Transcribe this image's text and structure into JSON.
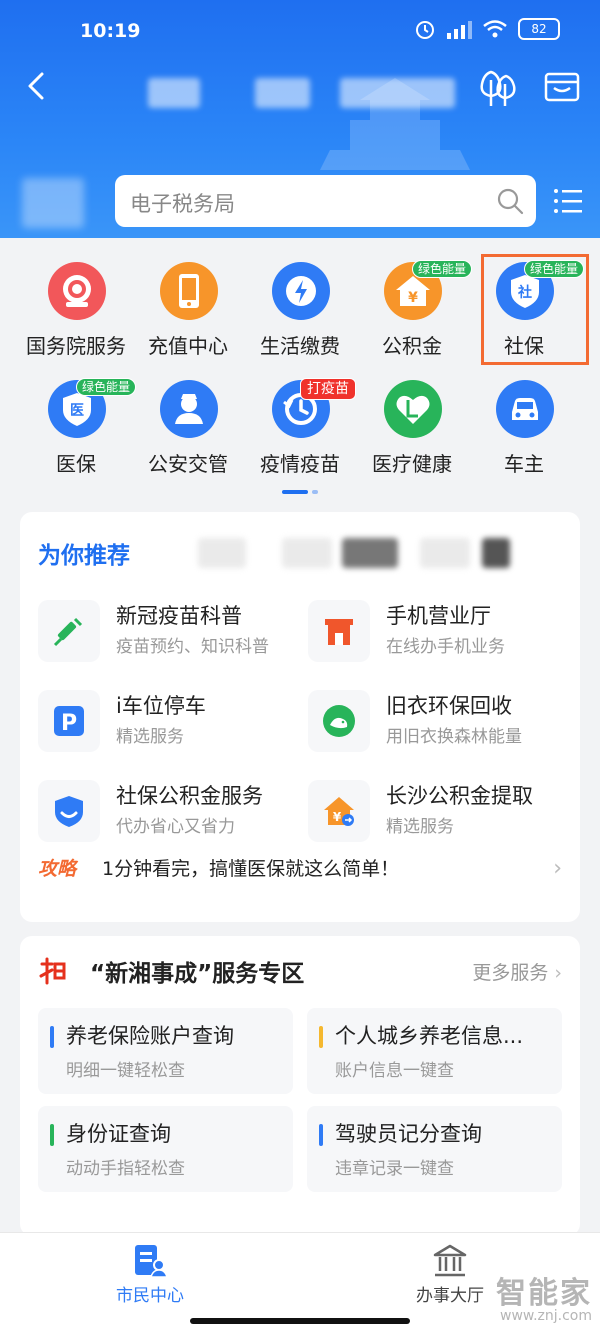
{
  "status_bar": {
    "time": "10:19",
    "battery": "82"
  },
  "header": {
    "search_placeholder": "电子税务局",
    "colors": {
      "primary": "#1f6ff0"
    }
  },
  "grid": {
    "items": [
      {
        "label": "国务院服务",
        "icon": "seal-icon"
      },
      {
        "label": "充值中心",
        "icon": "phone-icon"
      },
      {
        "label": "生活缴费",
        "icon": "lightning-icon"
      },
      {
        "label": "公积金",
        "icon": "house-yuan-icon",
        "badge": "绿色能量"
      },
      {
        "label": "社保",
        "icon": "shield-social-icon",
        "badge": "绿色能量"
      },
      {
        "label": "医保",
        "icon": "shield-medical-icon",
        "badge": "绿色能量"
      },
      {
        "label": "公安交管",
        "icon": "police-icon"
      },
      {
        "label": "疫情疫苗",
        "icon": "history-icon",
        "badge": "打疫苗"
      },
      {
        "label": "医疗健康",
        "icon": "health-heart-icon"
      },
      {
        "label": "车主",
        "icon": "car-icon"
      }
    ]
  },
  "recommend": {
    "title": "为你推荐",
    "items": [
      {
        "name": "新冠疫苗科普",
        "desc": "疫苗预约、知识科普"
      },
      {
        "name": "手机营业厅",
        "desc": "在线办手机业务"
      },
      {
        "name": "i车位停车",
        "desc": "精选服务"
      },
      {
        "name": "旧衣环保回收",
        "desc": "用旧衣换森林能量"
      },
      {
        "name": "社保公积金服务",
        "desc": "代办省心又省力"
      },
      {
        "name": "长沙公积金提取",
        "desc": "精选服务"
      }
    ],
    "tip_tag": "攻略",
    "tip_text": "1分钟看完，搞懂医保就这么简单！"
  },
  "zone": {
    "title": "“新湘事成”服务专区",
    "more": "更多服务",
    "items": [
      {
        "name": "养老保险账户查询",
        "desc": "明细一键轻松查",
        "color": "#2f7bf5"
      },
      {
        "name": "个人城乡养老信息...",
        "desc": "账户信息一键查",
        "color": "#f5b82f"
      },
      {
        "name": "身份证查询",
        "desc": "动动手指轻松查",
        "color": "#28b45a"
      },
      {
        "name": "驾驶员记分查询",
        "desc": "违章记录一键查",
        "color": "#2f7bf5"
      }
    ]
  },
  "nav": {
    "items": [
      {
        "label": "市民中心"
      },
      {
        "label": "办事大厅"
      }
    ]
  },
  "watermark": {
    "big": "智能家",
    "small": "www.znj.com"
  }
}
